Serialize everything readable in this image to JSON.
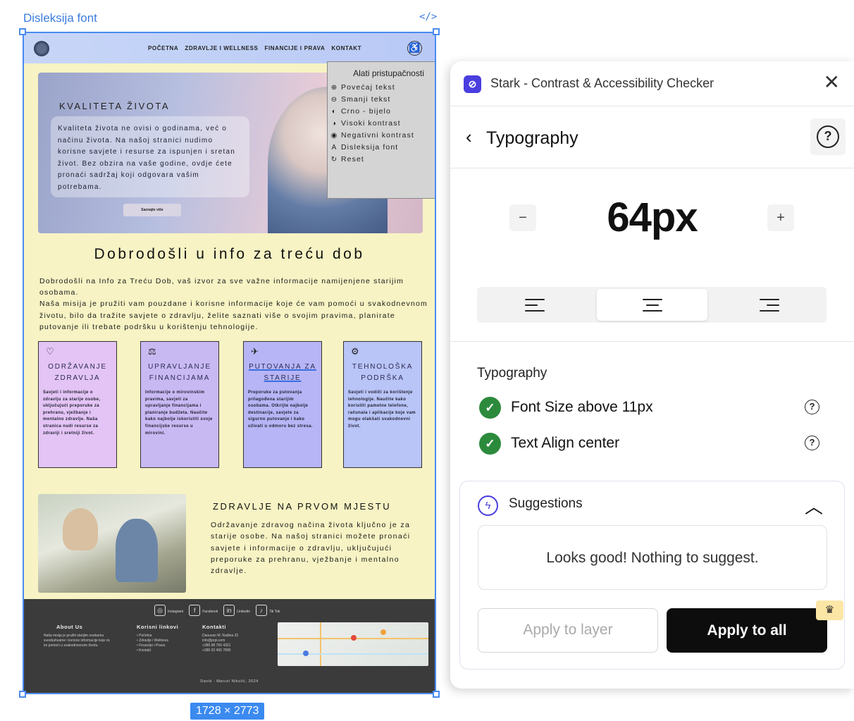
{
  "canvas": {
    "frame_label": "Disleksija font",
    "code_icon_label": "</>",
    "dimensions": "1728 × 2773"
  },
  "site": {
    "nav": [
      "POČETNA",
      "ZDRAVLJE I WELLNESS",
      "FINANCIJE I PRAVA",
      "KONTAKT"
    ],
    "hero_title": "KVALITETA ŽIVOTA",
    "hero_text": "Kvaliteta života ne ovisi o godinama, već o načinu života. Na našoj stranici nudimo korisne savjete i resurse za ispunjen i sretan život. Bez obzira na vaše godine, ovdje ćete pronaći sadržaj koji odgovara vašim potrebama.",
    "hero_button": "Saznajte više",
    "accessibility": {
      "title": "Alati pristupačnosti",
      "items": [
        {
          "icon": "⊕",
          "label": "Povećaj tekst"
        },
        {
          "icon": "⊖",
          "label": "Smanji tekst"
        },
        {
          "icon": "◐",
          "label": "Crno - bijelo"
        },
        {
          "icon": "◑",
          "label": "Visoki kontrast"
        },
        {
          "icon": "◉",
          "label": "Negativni kontrast"
        },
        {
          "icon": "A",
          "label": "Disleksija font"
        },
        {
          "icon": "↻",
          "label": "Reset"
        }
      ]
    },
    "welcome_title": "Dobrodošli u info za treću dob",
    "welcome_text_1": "Dobrodošli na Info za Treću Dob, vaš izvor za sve važne informacije namijenjene starijim osobama.",
    "welcome_text_2": "Naša misija je pružiti vam pouzdane i korisne informacije koje će vam pomoći u svakodnevnom životu, bilo da tražite savjete o zdravlju, želite saznati više o svojim pravima, planirate putovanje ili trebate podršku u korištenju tehnologije.",
    "cards": [
      {
        "icon": "♡",
        "title": "ODRŽAVANJE ZDRAVLJA",
        "text": "Savjeti i informacije o zdravlju za starije osobe, uključujući preporuke za prehranu, vježbanje i mentalno zdravlje. Naša stranica nudi resurse za zdraviji i sretniji život.",
        "color": "#e3c4f5"
      },
      {
        "icon": "⚖",
        "title": "UPRAVLJANJE FINANCIJAMA",
        "text": "Informacije o mirovinskim pravima, savjeti za upravljanje financijama i planiranje budžeta. Naučite kako najbolje iskoristiti svoje financijske resurse u mirovini.",
        "color": "#c9b9f3"
      },
      {
        "icon": "✈",
        "title": "PUTOVANJA ZA STARIJE",
        "text": "Preporuke za putovanja prilagođena starijim osobama. Otkrijte najbolje destinacije, savjete za sigurno putovanje i kako uživati u odmoru bez stresa.",
        "color": "#b7b5f5"
      },
      {
        "icon": "⚙",
        "title": "TEHNOLOŠKA PODRŠKA",
        "text": "Savjeti i vodiči za korištenje tehnologije. Naučite kako koristiti pametne telefone, računala i aplikacije koje vam mogu olakšati svakodnevni život.",
        "color": "#b9c4f7"
      }
    ],
    "health_title": "ZDRAVLJE NA PRVOM MJESTU",
    "health_text": "Održavanje zdravog načina života ključno je za starije osobe. Na našoj stranici možete pronaći savjete i informacije o zdravlju, uključujući preporuke za prehranu, vježbanje i mentalno zdravlje.",
    "footer": {
      "social": [
        "Instagram",
        "Facebook",
        "Linkedin",
        "Tik Tok"
      ],
      "about_title": "About Us",
      "about_text": "Naša misija je pružiti starijim osobama sveobuhvatne i korisne informacije koje će im pomoći u svakodnevnom životu.",
      "links_title": "Korisni linkovi",
      "links": [
        "• Početna",
        "• Zdravlje i Wellness",
        "• Financije i Prava",
        "• Kontakt"
      ],
      "contact_title": "Kontakti",
      "contact": [
        "Danuvan M. Radina 32",
        "info@prpi.com",
        "+385 98 765 4321",
        "+385 03 456 7890"
      ],
      "copyright": "David - Marcel Nikolić, 2024"
    }
  },
  "stark": {
    "app_title": "Stark - Contrast & Accessibility Checker",
    "close": "✕",
    "section_title": "Typography",
    "font_size": "64px",
    "decrement": "−",
    "increment": "+",
    "align_options": [
      "left",
      "center",
      "right"
    ],
    "align_active": "center",
    "checks_title": "Typography",
    "checks": [
      {
        "label": "Font Size above 11px",
        "status": "pass"
      },
      {
        "label": "Text Align center",
        "status": "pass"
      }
    ],
    "suggestions_title": "Suggestions",
    "suggestion_text": "Looks good! Nothing to suggest.",
    "apply_layer": "Apply to layer",
    "apply_all": "Apply to all",
    "colors": {
      "accent": "#4a3ee0",
      "pass": "#2c8a3c",
      "primary_button": "#0d0d0d",
      "premium": "#fbe6a6"
    }
  }
}
